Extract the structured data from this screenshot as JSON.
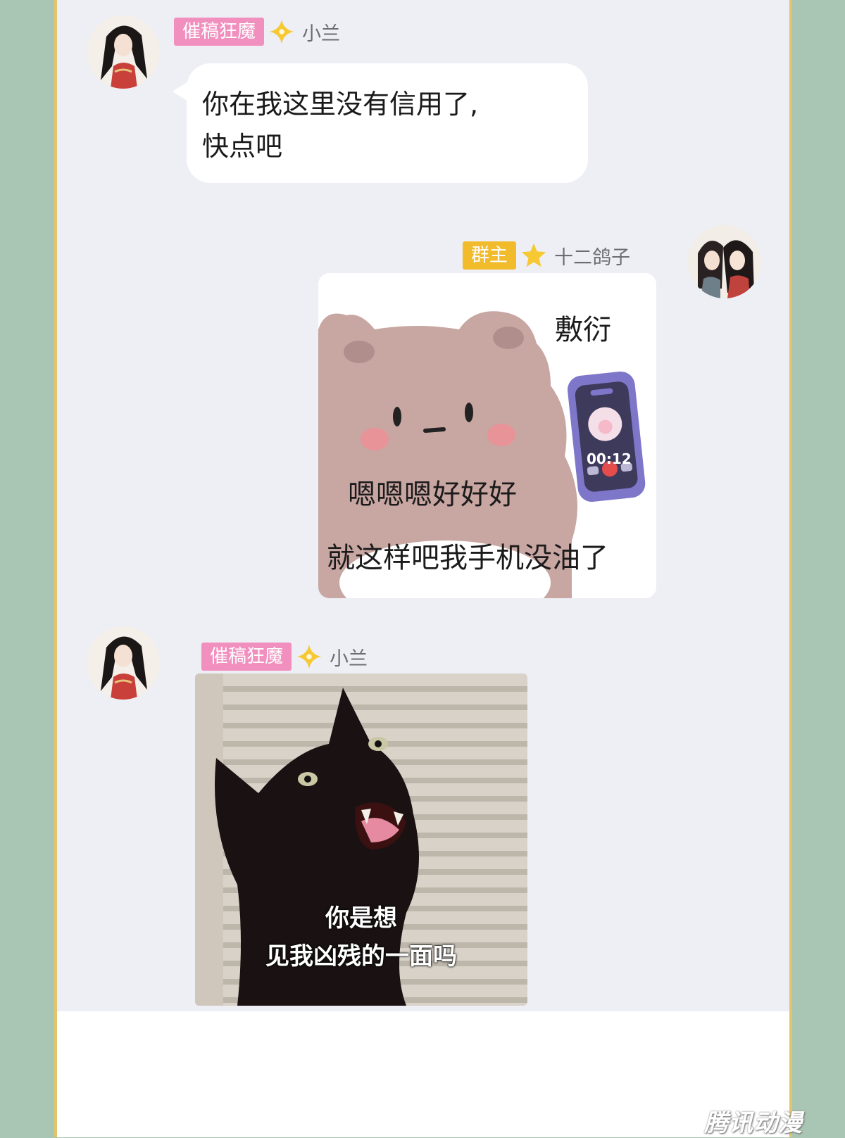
{
  "messages": [
    {
      "tag": "催稿狂魔",
      "name": "小兰",
      "lines": [
        "你在我这里没有信用了,",
        "快点吧"
      ]
    },
    {
      "tag": "群主",
      "name": "十二鸽子",
      "sticker_text": {
        "top": "敷衍",
        "phone_time": "00:12",
        "line1": "嗯嗯嗯好好好",
        "line2": "就这样吧我手机没油了"
      }
    },
    {
      "tag": "催稿狂魔",
      "name": "小兰",
      "sticker_text": {
        "line1": "你是想",
        "line2": "见我凶残的一面吗"
      }
    }
  ],
  "watermark": "腾讯动漫",
  "colors": {
    "tag_pink": "#f18fbf",
    "tag_yellow": "#f2bb2c",
    "chat_bg": "#eeeef5",
    "side_bg": "#a9c5b3",
    "frame_gold": "#e2c46a"
  },
  "icons": [
    "star-badge-icon"
  ]
}
